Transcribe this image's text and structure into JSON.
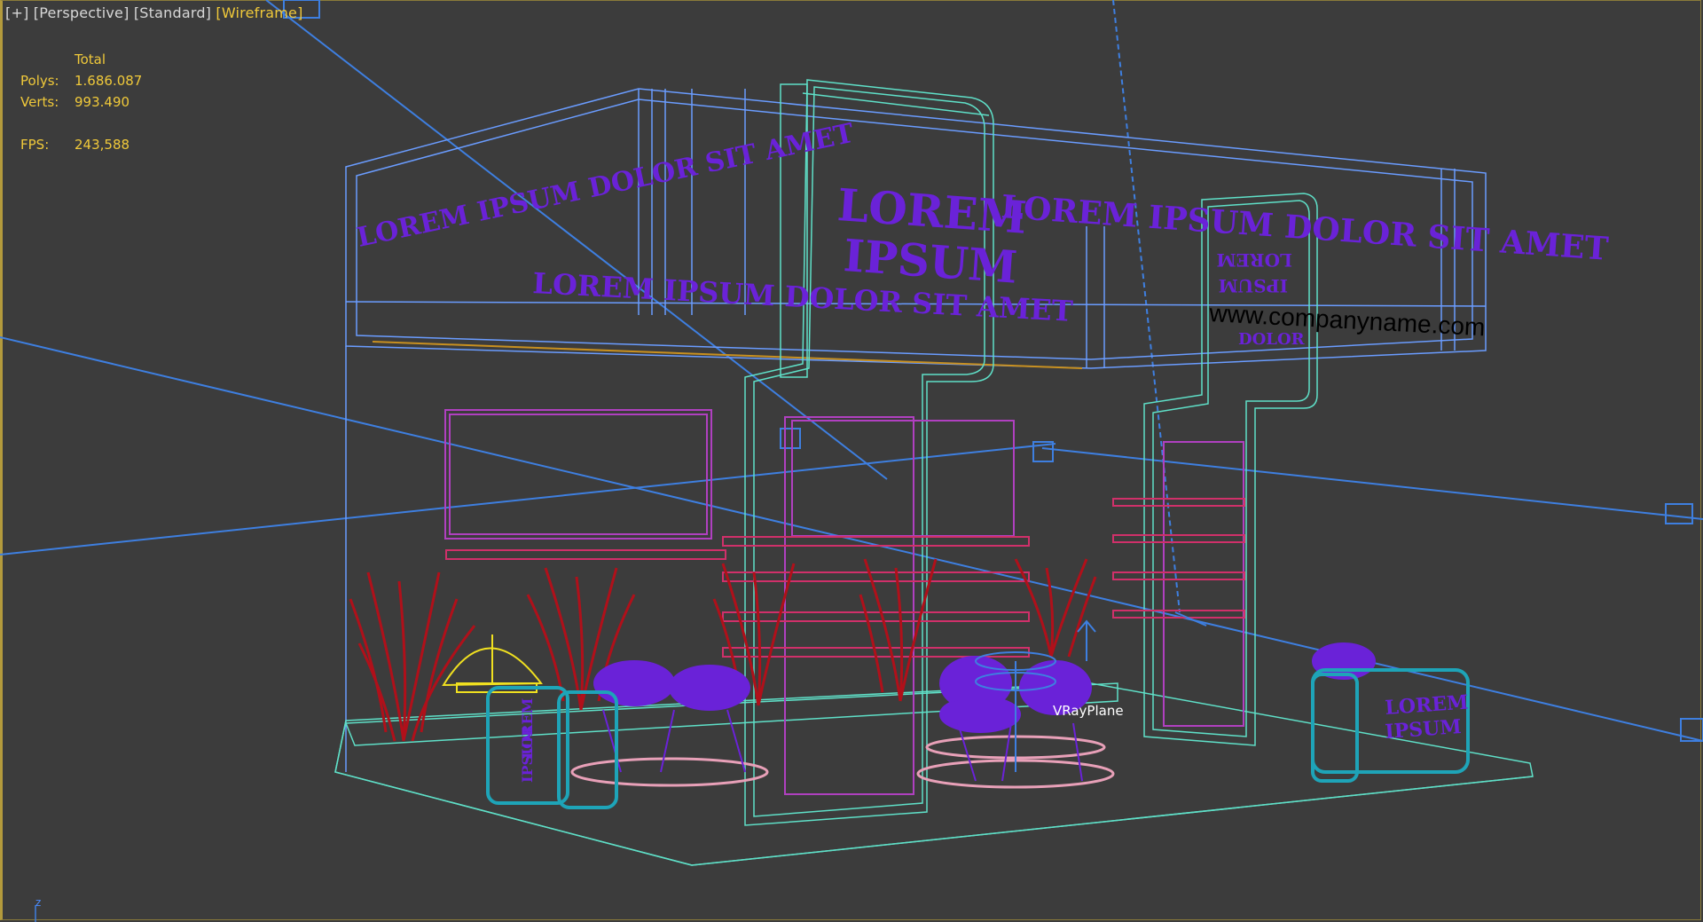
{
  "viewport": {
    "labels": [
      "[+]",
      "[Perspective]",
      "[Standard]",
      "[Wireframe]"
    ],
    "active_label": "[Wireframe]"
  },
  "stats": {
    "header": "Total",
    "polys_label": "Polys:",
    "polys_value": "1.686.087",
    "verts_label": "Verts:",
    "verts_value": "993.490",
    "fps_label": "FPS:",
    "fps_value": "243,588"
  },
  "scene": {
    "banner_left": "LOREM IPSUM DOLOR SIT AMET",
    "banner_center_line1": "LOREM",
    "banner_center_line2": "IPSUM",
    "banner_lower": "LOREM IPSUM DOLOR SIT AMET",
    "banner_right": "LOREM IPSUM DOLOR SIT AMET",
    "tower_text_1": "LOREM",
    "tower_text_2": "IPSUM",
    "tower_text_3": "DOLOR",
    "website": "www.companyname.com",
    "counter_right_1": "LOREM",
    "counter_right_2": "IPSUM",
    "counter_left_1": "LOREM",
    "counter_left_2": "IPSUM",
    "object_label": "VRayPlane",
    "axis_label": "z"
  },
  "colors": {
    "background": "#3c3c3c",
    "accent": "#f0c93a",
    "structure_cyan": "#5fe0c8",
    "structure_blue": "#6a9cff",
    "text_purple": "#6a22d8",
    "shelf_pink": "#d0306a",
    "plant_red": "#b0101a",
    "rug_pink": "#e8a0b8",
    "light_yellow": "#f0e020"
  }
}
